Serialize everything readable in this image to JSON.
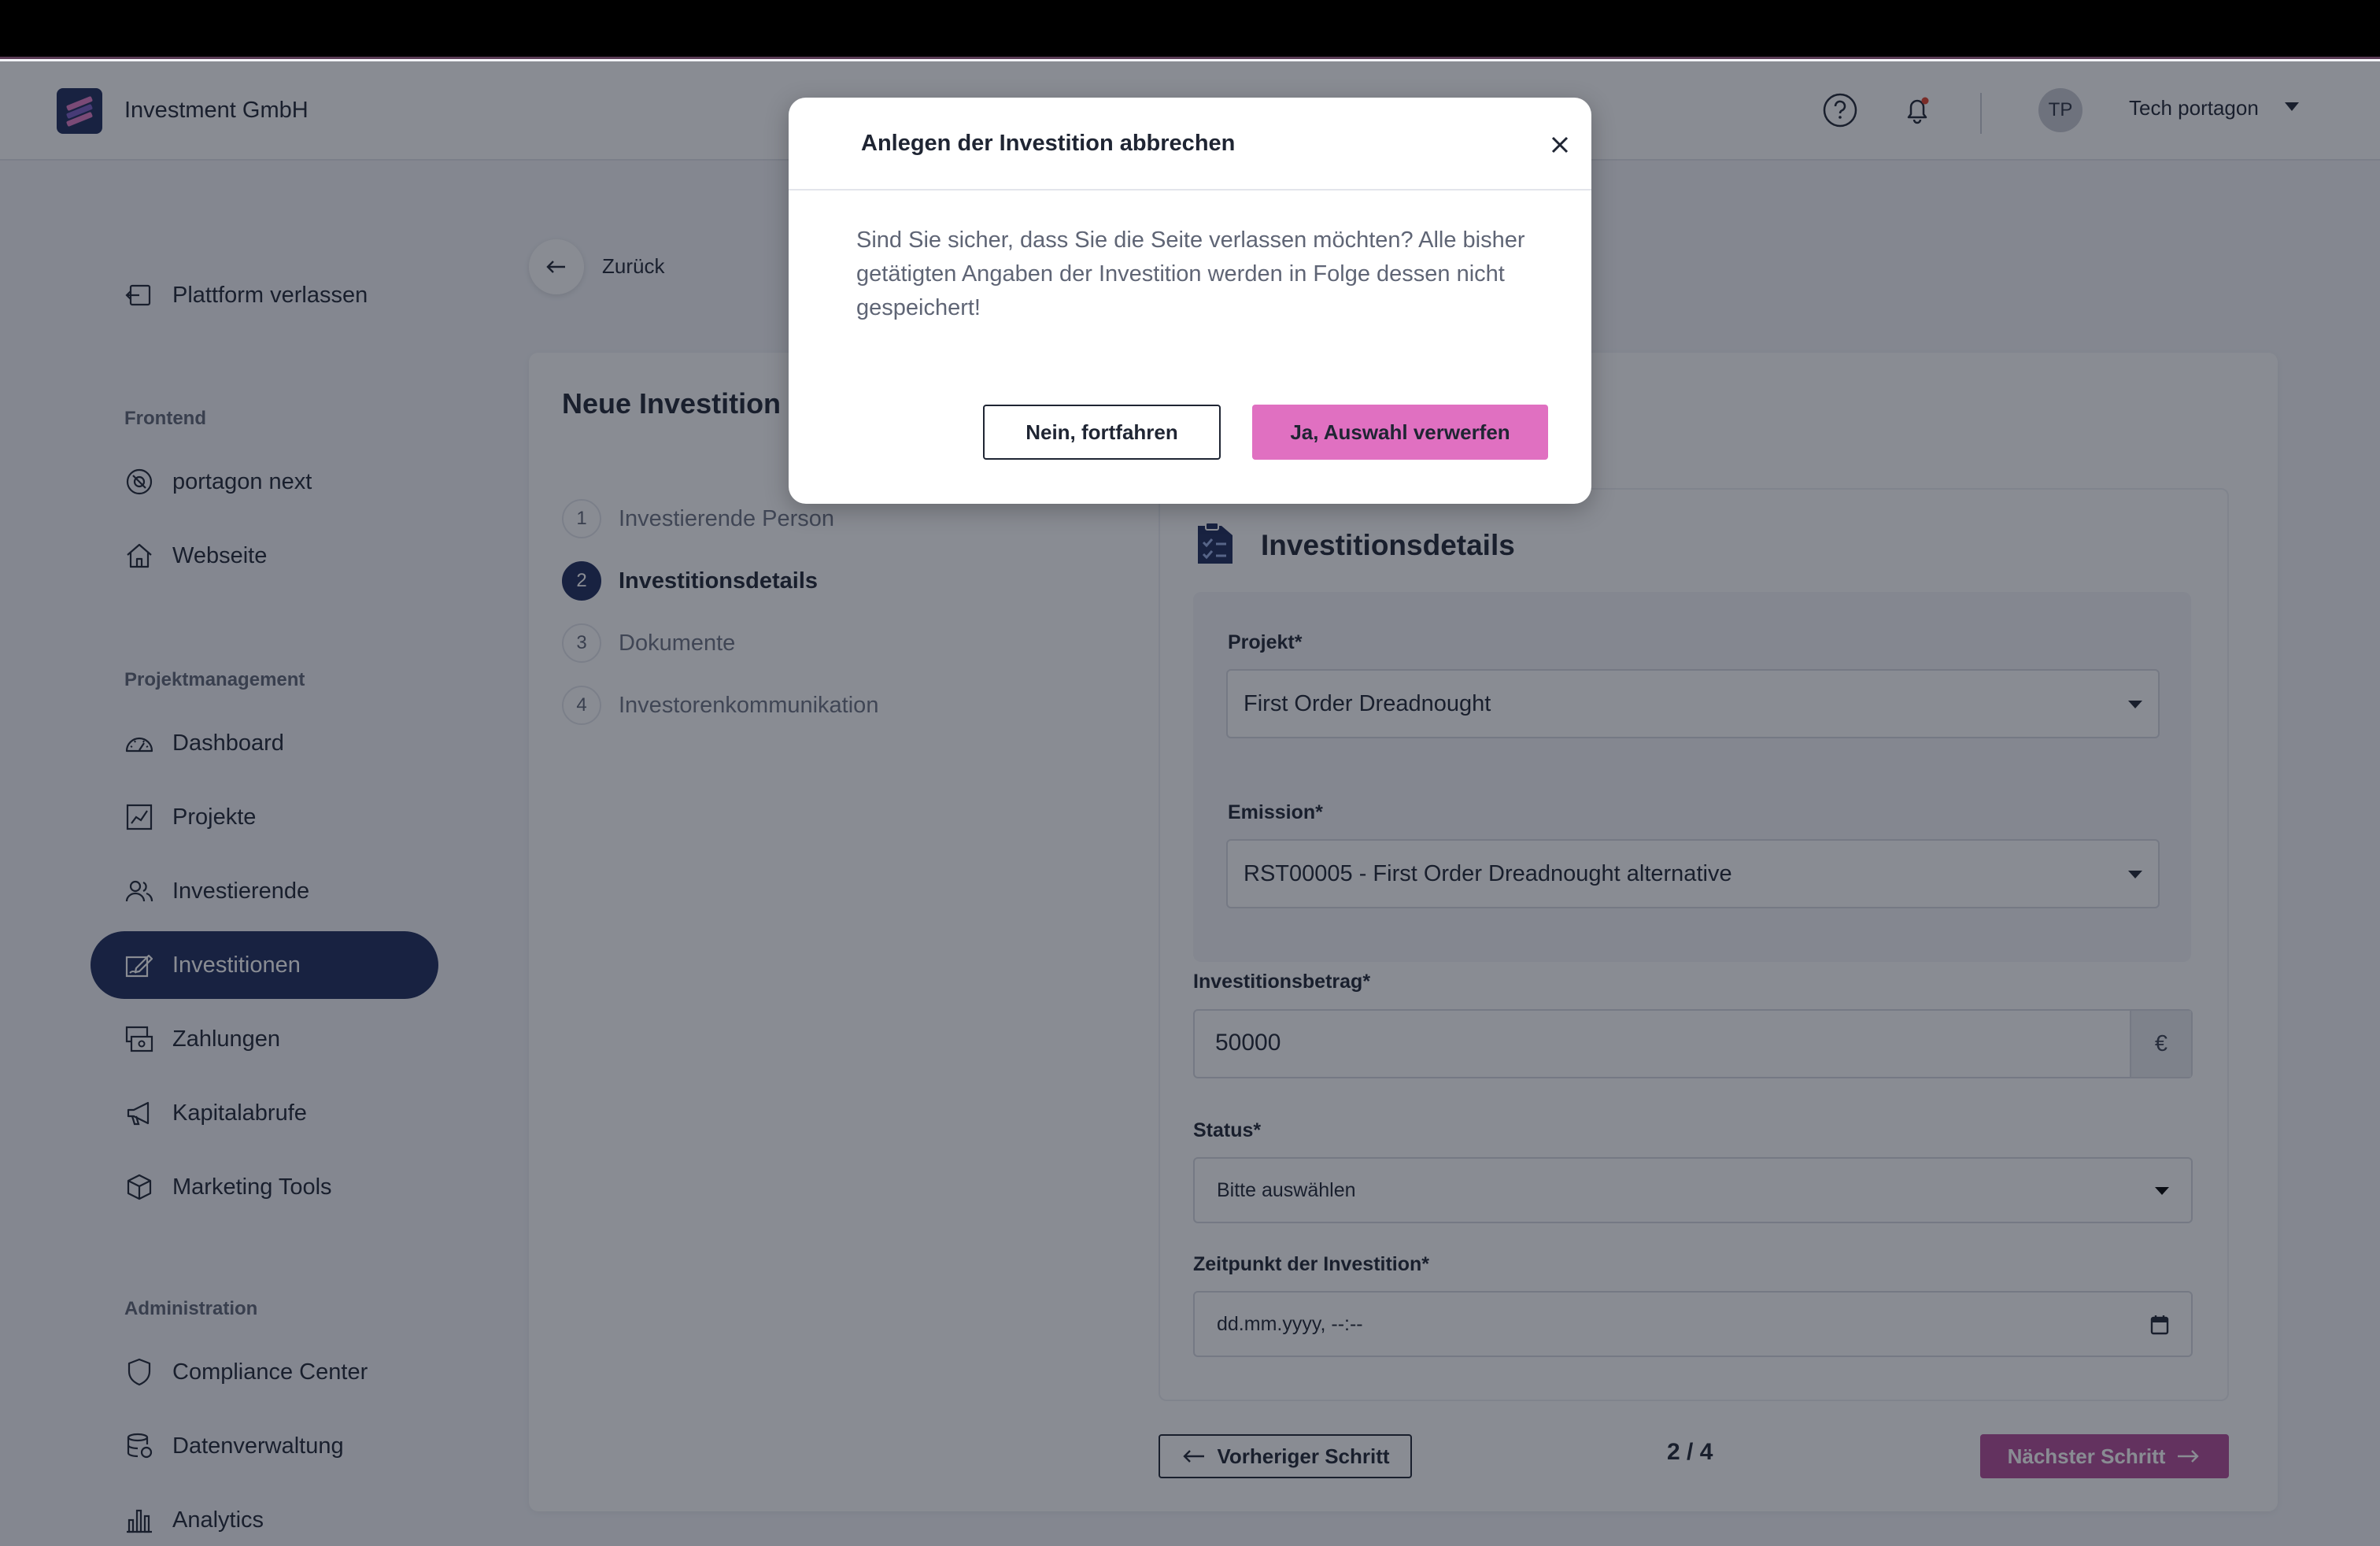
{
  "header": {
    "company": "Investment GmbH",
    "user_initials": "TP",
    "user_name": "Tech portagon"
  },
  "sidebar": {
    "leave": "Plattform verlassen",
    "sections": [
      {
        "heading": "Frontend",
        "items": [
          "portagon next",
          "Webseite"
        ]
      },
      {
        "heading": "Projektmanagement",
        "items": [
          "Dashboard",
          "Projekte",
          "Investierende",
          "Investitionen",
          "Zahlungen",
          "Kapitalabrufe",
          "Marketing Tools"
        ]
      },
      {
        "heading": "Administration",
        "items": [
          "Compliance Center",
          "Datenverwaltung",
          "Analytics"
        ]
      }
    ],
    "active_item": "Investitionen"
  },
  "page": {
    "back_label": "Zurück",
    "title": "Neue Investition a",
    "steps": [
      {
        "num": "1",
        "label": "Investierende Person"
      },
      {
        "num": "2",
        "label": "Investitionsdetails"
      },
      {
        "num": "3",
        "label": "Dokumente"
      },
      {
        "num": "4",
        "label": "Investorenkommunikation"
      }
    ],
    "active_step": 2
  },
  "form": {
    "section_title": "Investitionsdetails",
    "project_label": "Projekt*",
    "project_value": "First Order Dreadnought",
    "emission_label": "Emission*",
    "emission_value": "RST00005 - First Order Dreadnought alternative",
    "amount_label": "Investitionsbetrag*",
    "amount_value": "50000",
    "currency": "€",
    "status_label": "Status*",
    "status_value": "Bitte auswählen",
    "date_label": "Zeitpunkt der Investition*",
    "date_value": "dd.mm.yyyy, --:--"
  },
  "nav": {
    "prev": "Vorheriger Schritt",
    "pager": "2 / 4",
    "next": "Nächster Schritt"
  },
  "modal": {
    "title": "Anlegen der Investition abbrechen",
    "body": "Sind Sie sicher, dass Sie die Seite verlassen möchten? Alle bisher getätigten Angaben der Investition werden in Folge dessen nicht gespeichert!",
    "cancel": "Nein, fortfahren",
    "confirm": "Ja, Auswahl verwerfen"
  },
  "colors": {
    "brand_navy": "#1c2a5a",
    "accent_pink": "#e070c1"
  }
}
